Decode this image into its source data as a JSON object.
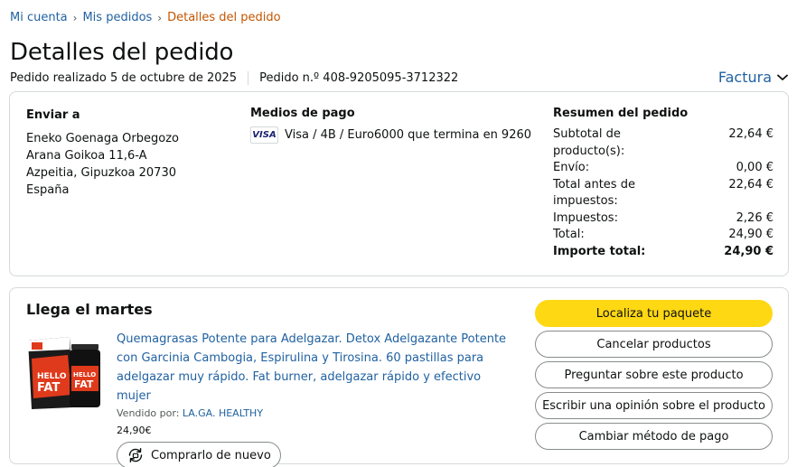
{
  "breadcrumb": {
    "items": [
      "Mi cuenta",
      "Mis pedidos"
    ],
    "current": "Detalles del pedido",
    "separator": "›"
  },
  "page_title": "Detalles del pedido",
  "order_meta": {
    "placed": "Pedido realizado 5 de octubre de 2025",
    "number": "Pedido n.º 408-9205095-3712322"
  },
  "invoice": {
    "label": "Factura",
    "icon": "chevron-down-icon"
  },
  "shipping": {
    "heading": "Enviar a",
    "lines": [
      "Eneko Goenaga Orbegozo",
      "Arana Goikoa 11,6-A",
      "Azpeitia, Gipuzkoa 20730",
      "España"
    ]
  },
  "payment": {
    "heading": "Medios de pago",
    "card_brand": "VISA",
    "description": "Visa / 4B / Euro6000  que termina en 9260"
  },
  "summary": {
    "heading": "Resumen del pedido",
    "rows": [
      {
        "label": "Subtotal de producto(s):",
        "value": "22,64 €"
      },
      {
        "label": "Envío:",
        "value": "0,00 €"
      },
      {
        "label": "Total antes de impuestos:",
        "value": "22,64 €"
      },
      {
        "label": "Impuestos:",
        "value": "2,26 €"
      },
      {
        "label": "Total:",
        "value": "24,90 €"
      },
      {
        "label": "Importe total:",
        "value": "24,90 €"
      }
    ]
  },
  "delivery": {
    "title": "Llega el martes",
    "product": {
      "title": "Quemagrasas Potente para Adelgazar. Detox Adelgazante Potente con Garcinia Cambogia, Espirulina y Tirosina. 60 pastillas para adelgazar muy rápido. Fat burner, adelgazar rápido y efectivo mujer",
      "sold_by_label": "Vendido por:",
      "seller": "LA.GA. HEALTHY",
      "price": "24,90€",
      "image_text": "HELLO FAT",
      "buy_again": "Comprarlo de nuevo",
      "buy_again_icon": "reorder-icon"
    },
    "actions": [
      "Localiza tu paquete",
      "Cancelar productos",
      "Preguntar sobre este producto",
      "Escribir una opinión sobre el producto",
      "Cambiar método de pago"
    ]
  },
  "colors": {
    "link": "#2162a1",
    "breadcrumb_current": "#c45500",
    "primary_button": "#ffd814",
    "border": "#d5d9d9",
    "product_red": "#e03a1c"
  }
}
